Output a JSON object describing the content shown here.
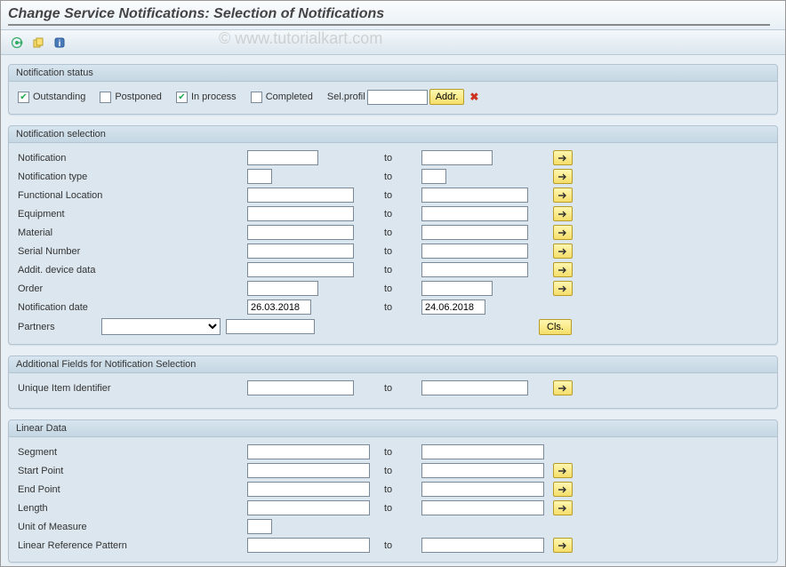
{
  "title": "Change Service Notifications: Selection of Notifications",
  "watermark": "© www.tutorialkart.com",
  "toolbar": {
    "execute": "execute-icon",
    "variant": "variant-icon",
    "info": "info-icon"
  },
  "groups": {
    "status": {
      "title": "Notification status",
      "checkboxes": [
        {
          "label": "Outstanding",
          "checked": true
        },
        {
          "label": "Postponed",
          "checked": false
        },
        {
          "label": "In process",
          "checked": true
        },
        {
          "label": "Completed",
          "checked": false
        }
      ],
      "sel_profil_label": "Sel.profil",
      "sel_profil_value": "",
      "addr_btn": "Addr.",
      "delete_icon": "✖"
    },
    "selection": {
      "title": "Notification selection",
      "to_label": "to",
      "cls_btn": "Cls.",
      "fields": [
        {
          "label": "Notification",
          "from": "",
          "to": "",
          "short_from": true,
          "more": true
        },
        {
          "label": "Notification type",
          "from": "",
          "to": "",
          "tiny": true,
          "more": true
        },
        {
          "label": "Functional Location",
          "from": "",
          "to": "",
          "wide": true,
          "more": true
        },
        {
          "label": "Equipment",
          "from": "",
          "to": "",
          "wide": true,
          "more": true
        },
        {
          "label": "Material",
          "from": "",
          "to": "",
          "wide": true,
          "more": true
        },
        {
          "label": "Serial Number",
          "from": "",
          "to": "",
          "wide": true,
          "more": true
        },
        {
          "label": "Addit. device data",
          "from": "",
          "to": "",
          "wide": true,
          "more": true
        },
        {
          "label": "Order",
          "from": "",
          "to": "",
          "short_from": true,
          "more": true
        },
        {
          "label": "Notification date",
          "from": "26.03.2018",
          "to": "24.06.2018",
          "short_from": true,
          "more": false
        }
      ],
      "partners_label": "Partners",
      "partners_value": "",
      "partner_input": ""
    },
    "additional": {
      "title": "Additional Fields for Notification Selection",
      "to_label": "to",
      "fields": [
        {
          "label": "Unique Item Identifier",
          "from": "",
          "to": "",
          "more": true
        }
      ]
    },
    "linear": {
      "title": "Linear Data",
      "to_label": "to",
      "fields": [
        {
          "label": "Segment",
          "from": "",
          "to": "",
          "more": false
        },
        {
          "label": "Start Point",
          "from": "",
          "to": "",
          "more": true
        },
        {
          "label": "End Point",
          "from": "",
          "to": "",
          "more": true
        },
        {
          "label": "Length",
          "from": "",
          "to": "",
          "more": true
        }
      ],
      "uom_label": "Unit of Measure",
      "uom_value": "",
      "lrp_label": "Linear Reference Pattern",
      "lrp_from": "",
      "lrp_to": "",
      "lrp_more": true
    }
  }
}
